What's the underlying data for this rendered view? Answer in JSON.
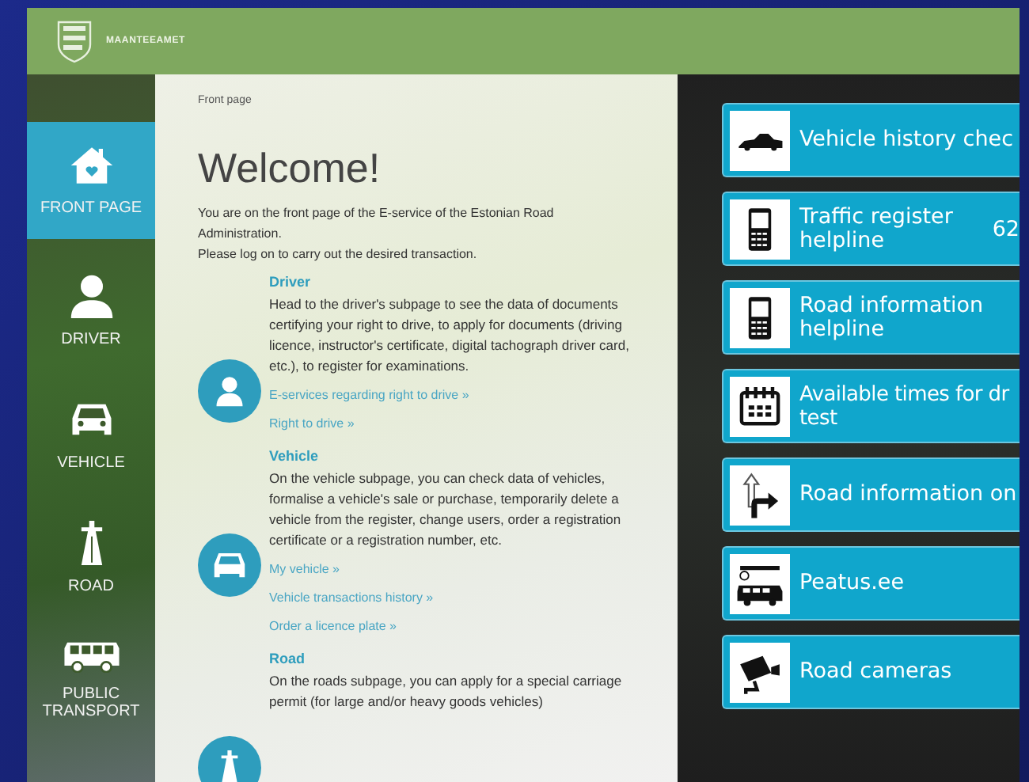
{
  "header": {
    "site_name": "MAANTEEAMET"
  },
  "sidebar": {
    "items": [
      {
        "label": "FRONT PAGE",
        "selected": true
      },
      {
        "label": "DRIVER",
        "selected": false
      },
      {
        "label": "VEHICLE",
        "selected": false
      },
      {
        "label": "ROAD",
        "selected": false
      },
      {
        "label": "PUBLIC TRANSPORT",
        "selected": false
      }
    ]
  },
  "content": {
    "breadcrumb": "Front page",
    "title": "Welcome!",
    "intro": [
      "You are on the front page of the E-service of the Estonian Road Administration.",
      "Please log on to carry out the desired transaction."
    ],
    "sections": [
      {
        "title": "Driver",
        "text": "Head to the driver's subpage to see the data of documents certifying your right to drive, to apply for documents (driving licence, instructor's certificate, digital tachograph driver card, etc.), to register for examinations.",
        "links": [
          "E-services regarding right to drive »",
          "Right to drive »"
        ]
      },
      {
        "title": "Vehicle",
        "text": "On the vehicle subpage, you can check data of vehicles, formalise a vehicle's sale or purchase, temporarily delete a vehicle from the register, change users, order a registration certificate or a registration number, etc.",
        "links": [
          "My vehicle »",
          "Vehicle transactions history »",
          "Order a licence plate »"
        ]
      },
      {
        "title": "Road",
        "text": "On the roads subpage, you can apply for a special carriage permit (for large and/or heavy goods vehicles)"
      }
    ]
  },
  "tiles": [
    {
      "label": "Vehicle history chec"
    },
    {
      "label": "Traffic register helpline",
      "number": "62"
    },
    {
      "label": "Road information helpline"
    },
    {
      "label": "Available times for dr test"
    },
    {
      "label": "Road information on"
    },
    {
      "label": "Peatus.ee"
    },
    {
      "label": "Road cameras"
    }
  ]
}
